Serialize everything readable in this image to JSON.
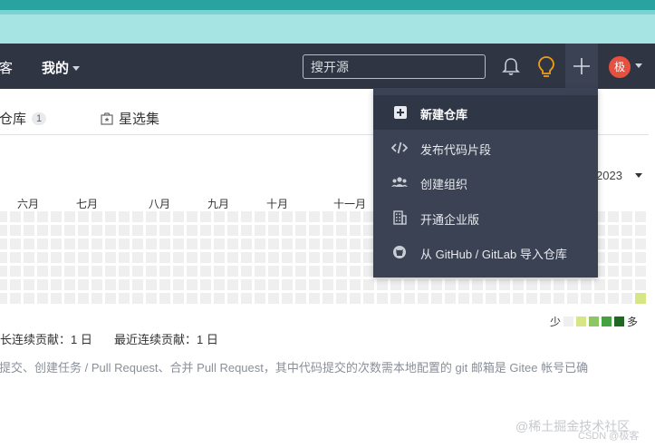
{
  "navbar": {
    "left_cut_text": "客",
    "mine_label": "我的",
    "search_placeholder": "搜开源",
    "avatar_text": "极"
  },
  "tabs": {
    "repo_label": "仓库",
    "repo_count": "1",
    "star_label": "星选集"
  },
  "calendar": {
    "year": "2023",
    "months": [
      "六月",
      "七月",
      "八月",
      "九月",
      "十月",
      "十一月"
    ],
    "legend_less": "少",
    "legend_more": "多",
    "legend_colors": [
      "#efefef",
      "#d6e685",
      "#8cc665",
      "#44a340",
      "#1e6823"
    ],
    "active_cell_color": "#d6e685"
  },
  "stats": {
    "longest_streak": "长连续贡献：1 日",
    "recent_streak": "最近连续贡献：1 日",
    "description": "提交、创建任务 / Pull Request、合并 Pull Request，其中代码提交的次数需本地配置的 git 邮箱是 Gitee 帐号已确"
  },
  "dropdown": {
    "items": [
      {
        "label": "新建仓库",
        "icon": "plus-square-icon"
      },
      {
        "label": "发布代码片段",
        "icon": "code-icon"
      },
      {
        "label": "创建组织",
        "icon": "users-icon"
      },
      {
        "label": "开通企业版",
        "icon": "building-icon"
      },
      {
        "label": "从 GitHub / GitLab 导入仓库",
        "icon": "github-icon"
      }
    ]
  },
  "watermark": {
    "line1": "@稀土掘金技术社区",
    "line2": "CSDN @极客"
  }
}
